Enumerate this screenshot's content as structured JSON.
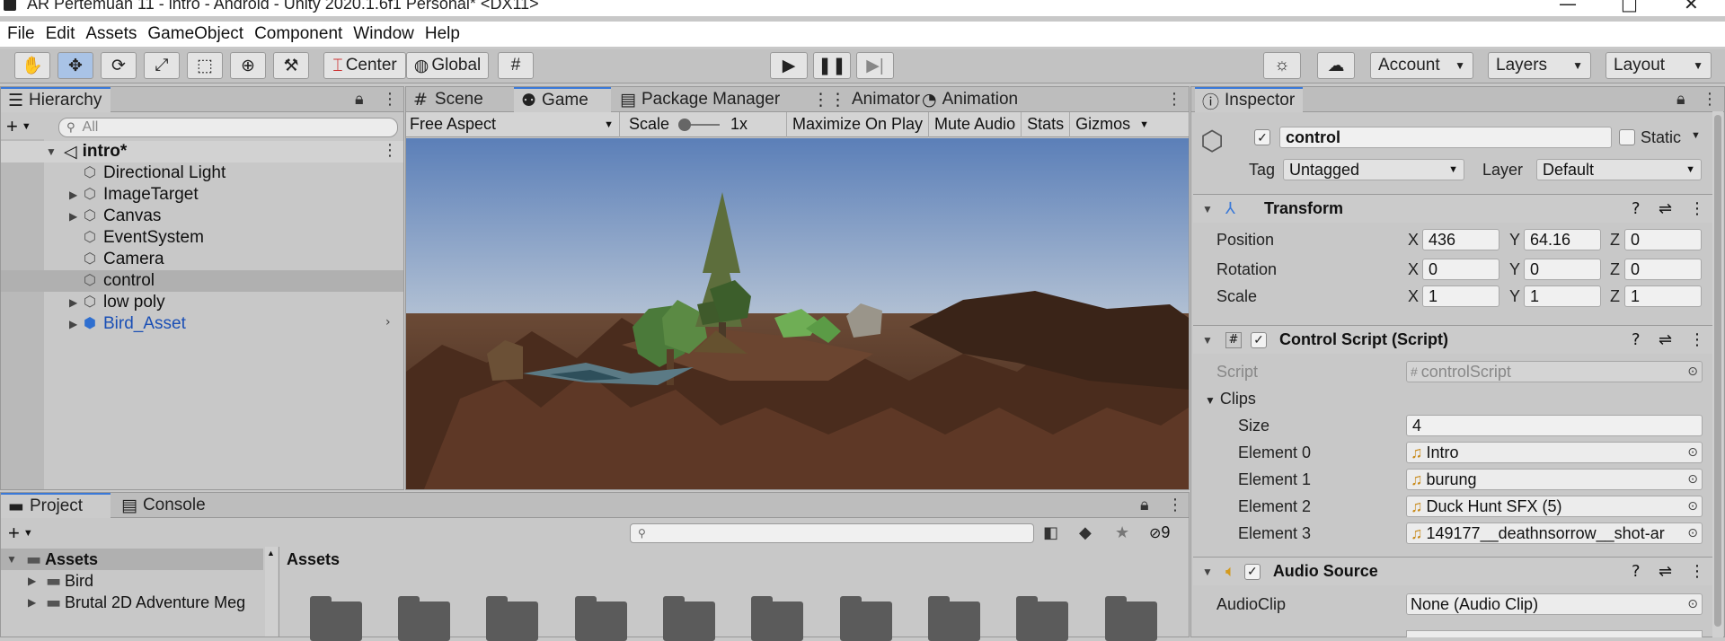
{
  "window": {
    "title": "AR Pertemuan 11 - intro - Android - Unity 2020.1.6f1 Personal* <DX11>",
    "minimize": "—",
    "maximize": "□",
    "close": "✕"
  },
  "menu": [
    "File",
    "Edit",
    "Assets",
    "GameObject",
    "Component",
    "Window",
    "Help"
  ],
  "toolbar": {
    "tools": [
      "hand-tool",
      "move-tool",
      "rotate-tool",
      "scale-tool",
      "rect-tool",
      "transform-tool",
      "custom-tool"
    ],
    "pivot": "Center",
    "space": "Global",
    "account": "Account",
    "layers": "Layers",
    "layout": "Layout"
  },
  "hierarchy": {
    "tab": "Hierarchy",
    "search_placeholder": "All",
    "scene": "intro*",
    "items": [
      {
        "label": "Directional Light",
        "expand": ""
      },
      {
        "label": "ImageTarget",
        "expand": "▶"
      },
      {
        "label": "Canvas",
        "expand": "▶"
      },
      {
        "label": "EventSystem",
        "expand": ""
      },
      {
        "label": "Camera",
        "expand": ""
      },
      {
        "label": "control",
        "expand": "",
        "selected": true
      },
      {
        "label": "low poly",
        "expand": "▶"
      },
      {
        "label": "Bird_Asset",
        "expand": "▶",
        "prefab": true
      }
    ]
  },
  "center_tabs": [
    "Scene",
    "Game",
    "Package Manager",
    "Animator",
    "Animation"
  ],
  "game_bar": {
    "aspect": "Free Aspect",
    "scale_label": "Scale",
    "scale_value": "1x",
    "maximize": "Maximize On Play",
    "mute": "Mute Audio",
    "stats": "Stats",
    "gizmos": "Gizmos"
  },
  "inspector": {
    "tab": "Inspector",
    "object_name": "control",
    "static_label": "Static",
    "tag_label": "Tag",
    "tag_value": "Untagged",
    "layer_label": "Layer",
    "layer_value": "Default",
    "transform": {
      "title": "Transform",
      "position_label": "Position",
      "position": {
        "x": "436",
        "y": "64.16",
        "z": "0"
      },
      "rotation_label": "Rotation",
      "rotation": {
        "x": "0",
        "y": "0",
        "z": "0"
      },
      "scale_label": "Scale",
      "scale": {
        "x": "1",
        "y": "1",
        "z": "1"
      }
    },
    "control_script": {
      "title": "Control Script (Script)",
      "script_label": "Script",
      "script_value": "controlScript",
      "clips_label": "Clips",
      "size_label": "Size",
      "size_value": "4",
      "elements": [
        {
          "label": "Element 0",
          "value": "Intro"
        },
        {
          "label": "Element 1",
          "value": "burung"
        },
        {
          "label": "Element 2",
          "value": "Duck Hunt SFX (5)"
        },
        {
          "label": "Element 3",
          "value": "149177__deathnsorrow__shot-ar"
        }
      ]
    },
    "audio_source": {
      "title": "Audio Source",
      "clip_label": "AudioClip",
      "clip_value": "None (Audio Clip)"
    }
  },
  "project": {
    "tabs": [
      "Project",
      "Console"
    ],
    "assets_root": "Assets",
    "tree": [
      "Bird",
      "Brutal 2D Adventure Meg"
    ],
    "breadcrumb": "Assets",
    "hidden_count": "9"
  },
  "axis_labels": {
    "x": "X",
    "y": "Y",
    "z": "Z"
  },
  "colors": {
    "accent": "#3a79d8",
    "panel": "#c8c8c8",
    "selected_row": "#b0b0b0",
    "prefab_text": "#1a4fb5"
  }
}
